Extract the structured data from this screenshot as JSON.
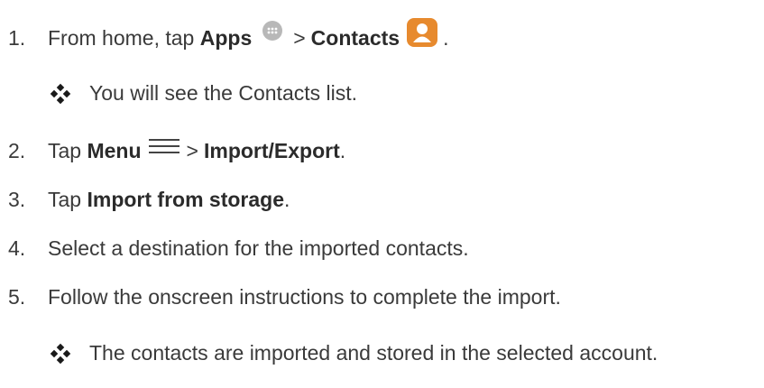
{
  "steps": {
    "s1": {
      "num": "1.",
      "text1": "From home, tap ",
      "bold1": "Apps",
      "sep": ">",
      "bold2": "Contacts",
      "end": "."
    },
    "r1": "You will see the Contacts list.",
    "s2": {
      "num": "2.",
      "text1": "Tap ",
      "bold1": "Menu",
      "sep": ">",
      "bold2": "Import/Export",
      "end": "."
    },
    "s3": {
      "num": "3.",
      "text1": "Tap ",
      "bold1": "Import from storage",
      "end": "."
    },
    "s4": {
      "num": "4.",
      "text": "Select a destination for the imported contacts."
    },
    "s5": {
      "num": "5.",
      "text": "Follow the onscreen instructions to complete the import."
    },
    "r2": "The contacts are imported and stored in the selected account."
  },
  "icons": {
    "apps": "apps-icon",
    "contacts": "contacts-icon",
    "menu": "menu-icon",
    "bullet": "diamond-bullet-icon"
  },
  "colors": {
    "text": "#3a3a3a",
    "contacts_icon": "#e78a2e",
    "apps_icon": "#b8b8b8"
  }
}
